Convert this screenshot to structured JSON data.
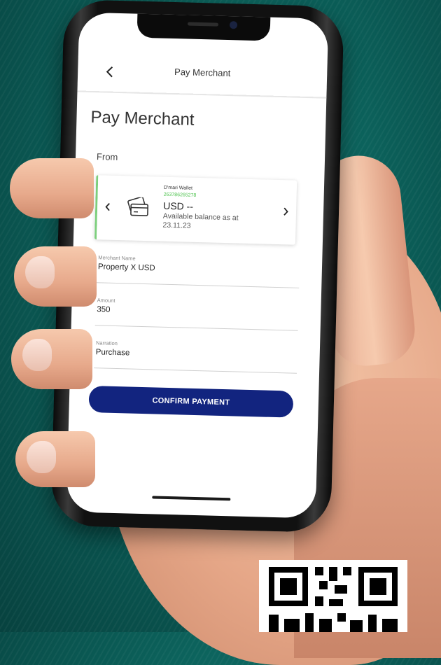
{
  "header": {
    "title": "Pay Merchant"
  },
  "page": {
    "title": "Pay Merchant",
    "from_label": "From"
  },
  "wallet": {
    "name": "D'mari Wallet",
    "number": "263786265278",
    "balance": "USD --",
    "balance_note": "Available balance as at 23.11.23"
  },
  "fields": [
    {
      "label": "Merchant Name",
      "value": "Property X USD"
    },
    {
      "label": "Amount",
      "value": "350"
    },
    {
      "label": "Narration",
      "value": "Purchase"
    }
  ],
  "actions": {
    "confirm_label": "CONFIRM PAYMENT"
  },
  "colors": {
    "primary": "#12247f",
    "accent_green": "#4cc24c",
    "background": "#0b5e58"
  },
  "icons": {
    "back": "chevron-left-icon",
    "card": "credit-card-icon",
    "prev": "chevron-left-icon",
    "next": "chevron-right-icon"
  }
}
